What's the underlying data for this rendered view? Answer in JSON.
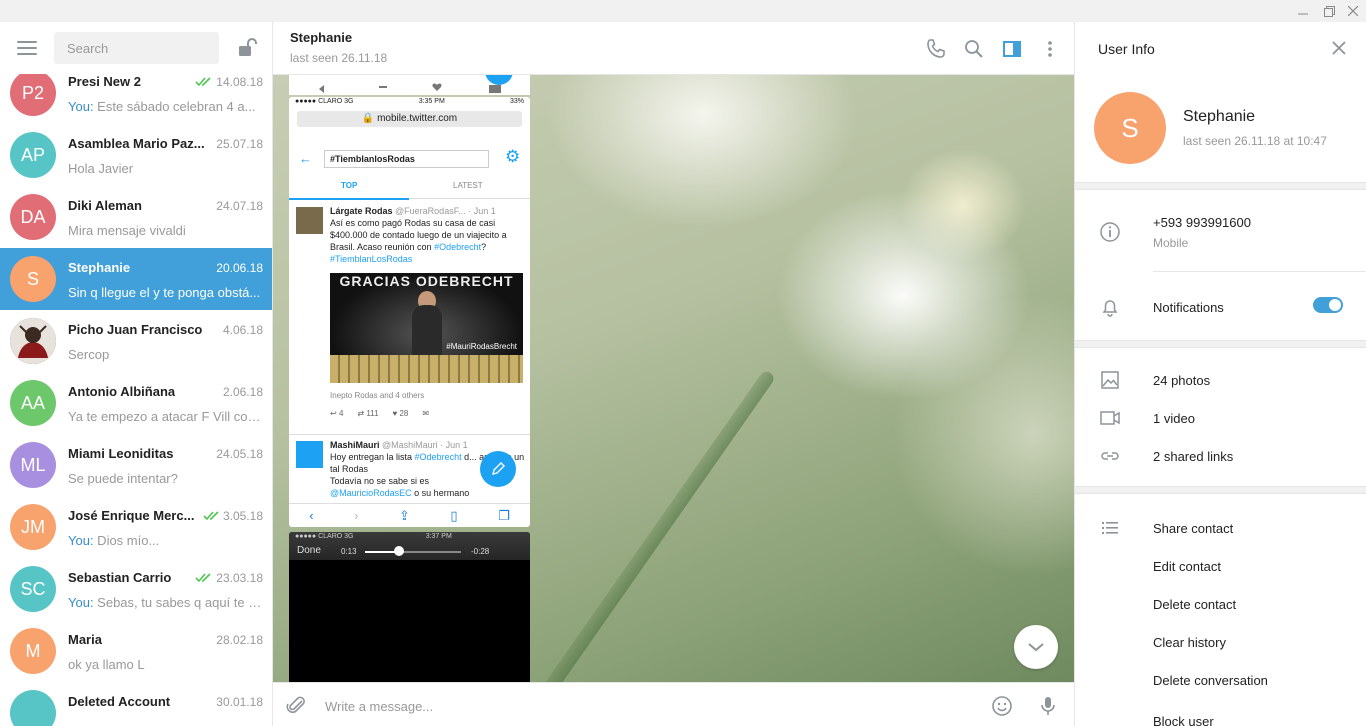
{
  "sidebar": {
    "search_placeholder": "Search",
    "chats": [
      {
        "initials": "P2",
        "color": "#e16e77",
        "name": "Presi New 2",
        "date": "14.08.18",
        "you": "You:",
        "preview": " Este sábado celebran 4 a...",
        "read": true
      },
      {
        "initials": "AP",
        "color": "#57c5c5",
        "name": "Asamblea Mario Paz...",
        "date": "25.07.18",
        "you": "",
        "preview": "Hola Javier",
        "read": false
      },
      {
        "initials": "DA",
        "color": "#e16e77",
        "name": "Diki Aleman",
        "date": "24.07.18",
        "you": "",
        "preview": "Mira mensaje vivaldi",
        "read": false
      },
      {
        "initials": "S",
        "color": "#f8a36e",
        "name": "Stephanie",
        "date": "20.06.18",
        "you": "",
        "preview": "Sin q llegue el y te ponga obstá...",
        "read": false,
        "active": true
      },
      {
        "initials": "",
        "color": "#5b3a2e",
        "name": "Picho Juan Francisco",
        "date": "4.06.18",
        "you": "",
        "preview": "Sercop",
        "read": false,
        "photo": true
      },
      {
        "initials": "AA",
        "color": "#6cc86b",
        "name": "Antonio Albiñana",
        "date": "2.06.18",
        "you": "",
        "preview": "Ya te empezo a atacar F Vill con...",
        "read": false
      },
      {
        "initials": "ML",
        "color": "#a98fe0",
        "name": "Miami Leoniditas",
        "date": "24.05.18",
        "you": "",
        "preview": "Se puede intentar?",
        "read": false
      },
      {
        "initials": "JM",
        "color": "#f8a36e",
        "name": "José Enrique Merc...",
        "date": "3.05.18",
        "you": "You:",
        "preview": " Dios mío...",
        "read": true
      },
      {
        "initials": "SC",
        "color": "#57c5c5",
        "name": "Sebastian Carrio",
        "date": "23.03.18",
        "you": "You:",
        "preview": " Sebas, tu sabes q aquí te q...",
        "read": true
      },
      {
        "initials": "M",
        "color": "#f8a36e",
        "name": "Maria",
        "date": "28.02.18",
        "you": "",
        "preview": "ok ya llamo L",
        "read": false
      },
      {
        "initials": "",
        "color": "#57c5c5",
        "name": "Deleted Account",
        "date": "30.01.18",
        "you": "",
        "preview": "",
        "read": false
      }
    ]
  },
  "chat": {
    "name": "Stephanie",
    "status": "last seen 26.11.18",
    "composer_placeholder": "Write a message..."
  },
  "tweet_screenshot": {
    "carrier": "●●●●● CLARO  3G",
    "time": "3:35 PM",
    "battery": "33%",
    "url": "mobile.twitter.com",
    "search_value": "#TiemblanlosRodas",
    "tab_top": "TOP",
    "tab_latest": "LATEST",
    "tweet1_name": "Lárgate Rodas",
    "tweet1_handle": " @FueraRodasF... · Jun 1",
    "tweet1_text_a": "Así es como pagó Rodas su casa de casi $400.000 de contado luego de un viajecito a Brasil. Acaso reunión con ",
    "tweet1_hashtag1": "#Odebrecht",
    "tweet1_text_b": "?",
    "tweet1_hashtag2": "#TiemblanLosRodas",
    "image_caption": "GRACIAS ODEBRECHT",
    "image_tag": "#MauriRodasBrecht",
    "likes_line": "Inepto Rodas and 4 others",
    "reply_count": "4",
    "retweet_count": "111",
    "like_count": "28",
    "tweet2_name": "MashiMauri",
    "tweet2_handle": " @MashiMauri · Jun 1",
    "tweet2_text_a": "Hoy entregan la lista ",
    "tweet2_hashtag": "#Odebrecht",
    "tweet2_text_b": " d... aparece un tal Rodas",
    "tweet2_text_c": "Todavía no se sabe si es",
    "tweet2_mention": "@MauricioRodasEC",
    "tweet2_text_d": " o su hermano"
  },
  "video_screenshot": {
    "carrier": "●●●●● CLARO  3G",
    "time": "3:37 PM",
    "done": "Done",
    "elapsed": "0:13",
    "remaining": "-0:28"
  },
  "info": {
    "title": "User Info",
    "initial": "S",
    "name": "Stephanie",
    "last_seen": "last seen 26.11.18 at 10:47",
    "phone": "+593 993991600",
    "phone_label": "Mobile",
    "notifications": "Notifications",
    "photos": "24 photos",
    "videos": "1 video",
    "links": "2 shared links",
    "share": "Share contact",
    "edit": "Edit contact",
    "delete": "Delete contact",
    "clear": "Clear history",
    "delete_conv": "Delete conversation",
    "block": "Block user"
  },
  "colors": {
    "accent": "#419fd9",
    "avatar_stephanie": "#f8a36e",
    "check": "#4dc64e"
  }
}
